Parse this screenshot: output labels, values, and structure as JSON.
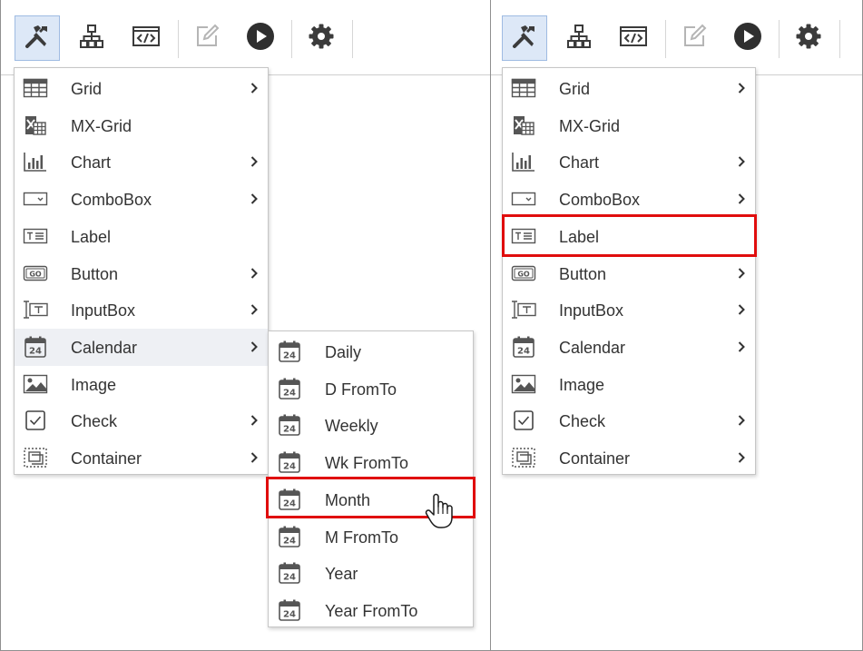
{
  "menu_items": [
    {
      "label": "Grid",
      "icon": "grid-icon",
      "submenu": true
    },
    {
      "label": "MX-Grid",
      "icon": "mx-grid-icon",
      "submenu": false
    },
    {
      "label": "Chart",
      "icon": "bar-chart-icon",
      "submenu": true
    },
    {
      "label": "ComboBox",
      "icon": "combobox-icon",
      "submenu": true
    },
    {
      "label": "Label",
      "icon": "label-icon",
      "submenu": false
    },
    {
      "label": "Button",
      "icon": "button-icon",
      "submenu": true
    },
    {
      "label": "InputBox",
      "icon": "inputbox-icon",
      "submenu": true
    },
    {
      "label": "Calendar",
      "icon": "calendar-icon",
      "submenu": true
    },
    {
      "label": "Image",
      "icon": "image-icon",
      "submenu": false
    },
    {
      "label": "Check",
      "icon": "checkbox-icon",
      "submenu": true
    },
    {
      "label": "Container",
      "icon": "container-icon",
      "submenu": true
    }
  ],
  "calendar_submenu": [
    {
      "label": "Daily",
      "icon": "calendar-icon"
    },
    {
      "label": "D FromTo",
      "icon": "calendar-icon"
    },
    {
      "label": "Weekly",
      "icon": "calendar-icon"
    },
    {
      "label": "Wk FromTo",
      "icon": "calendar-icon"
    },
    {
      "label": "Month",
      "icon": "calendar-icon"
    },
    {
      "label": "M FromTo",
      "icon": "calendar-icon"
    },
    {
      "label": "Year",
      "icon": "calendar-icon"
    },
    {
      "label": "Year FromTo",
      "icon": "calendar-icon"
    }
  ],
  "toolbar_icons": [
    "tools-icon",
    "hierarchy-icon",
    "code-icon",
    "edit-icon",
    "play-icon",
    "gear-icon"
  ],
  "calendar_day_number": "24",
  "highlight_color": "#e00d0d",
  "hover_background": "#eef0f4"
}
